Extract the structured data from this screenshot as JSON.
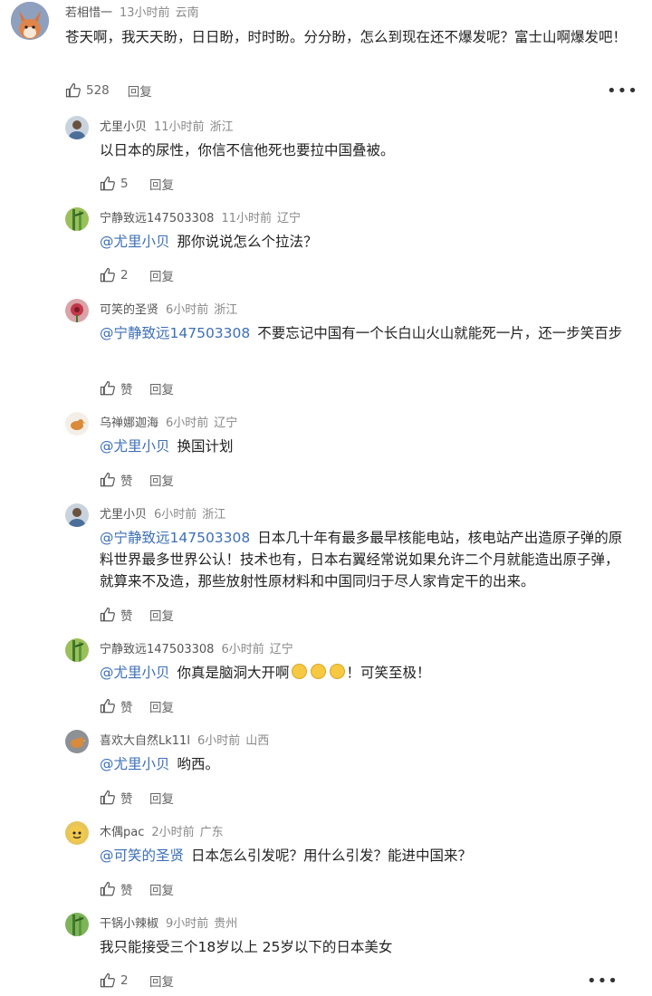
{
  "top_comment": {
    "user": "若相惜一",
    "time": "13小时前",
    "location": "云南",
    "text": "苍天啊，我天天盼，日日盼，时时盼。分分盼，怎么到现在还不爆发呢？富士山啊爆发吧！",
    "likes": "528",
    "reply_label": "回复",
    "more_label": "•••"
  },
  "replies": [
    {
      "user": "尤里小贝",
      "time": "11小时前",
      "location": "浙江",
      "mention": "",
      "text": "以日本的尿性，你信不信他死也要拉中国叠被。",
      "likes": "5",
      "reply_label": "回复"
    },
    {
      "user": "宁静致远147503308",
      "time": "11小时前",
      "location": "辽宁",
      "mention": "@尤里小贝",
      "text": "那你说说怎么个拉法？",
      "likes": "2",
      "reply_label": "回复"
    },
    {
      "user": "可笑的圣贤",
      "time": "6小时前",
      "location": "浙江",
      "mention": "@宁静致远147503308",
      "text": "不要忘记中国有一个长白山火山就能死一片，还一步笑百步",
      "likes": "赞",
      "reply_label": "回复"
    },
    {
      "user": "乌禅娜迦海",
      "time": "6小时前",
      "location": "辽宁",
      "mention": "@尤里小贝",
      "text": "换国计划",
      "likes": "赞",
      "reply_label": "回复"
    },
    {
      "user": "尤里小贝",
      "time": "6小时前",
      "location": "浙江",
      "mention": "@宁静致远147503308",
      "text": "日本几十年有最多最早核能电站，核电站产出造原子弹的原料世界最多世界公认！技术也有，日本右翼经常说如果允许二个月就能造出原子弹，就算来不及造，那些放射性原材料和中国同归于尽人家肯定干的出来。",
      "likes": "赞",
      "reply_label": "回复"
    },
    {
      "user": "宁静致远147503308",
      "time": "6小时前",
      "location": "辽宁",
      "mention": "@尤里小贝",
      "text": "你真是脑洞大开啊",
      "text_after": "！可笑至极！",
      "emoji_count": 3,
      "likes": "赞",
      "reply_label": "回复"
    },
    {
      "user": "喜欢大自然Lk11l",
      "time": "6小时前",
      "location": "山西",
      "mention": "@尤里小贝",
      "text": "哟西。",
      "likes": "赞",
      "reply_label": "回复"
    },
    {
      "user": "木偶pac",
      "time": "2小时前",
      "location": "广东",
      "mention": "@可笑的圣贤",
      "text": "日本怎么引发呢？用什么引发？能进中国来？",
      "likes": "赞",
      "reply_label": "回复"
    },
    {
      "user": "干锅小辣椒",
      "time": "9小时前",
      "location": "贵州",
      "mention": "",
      "text": "我只能接受三个18岁以上 25岁以下的日本美女",
      "likes": "2",
      "reply_label": "回复",
      "more_label": "•••"
    }
  ],
  "colors": {
    "mention": "#3d6fb6",
    "meta": "#888888",
    "text": "#222222"
  }
}
